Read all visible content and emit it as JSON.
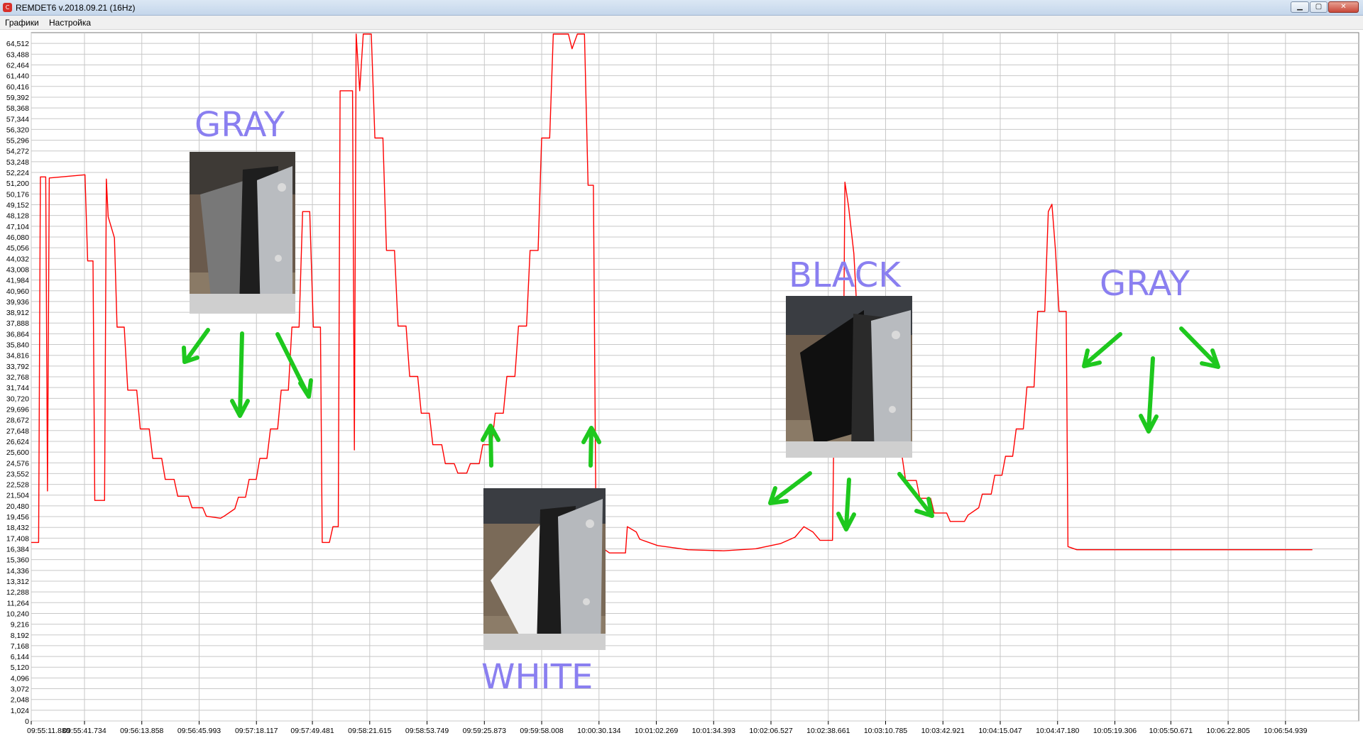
{
  "window": {
    "title": "REMDET6 v.2018.09.21 (16Hz)",
    "app_icon": "app-logo-icon",
    "controls": {
      "minimize": "▁",
      "maximize": "▢",
      "close": "✕"
    }
  },
  "menu": {
    "items": [
      "Графики",
      "Настройка"
    ]
  },
  "colors": {
    "series": "#ff0000",
    "grid": "#c8c8c8",
    "annotation_text": "#8a7ff0",
    "arrow": "#1ec81e"
  },
  "chart_data": {
    "type": "line",
    "grid": true,
    "ylim": [
      0,
      65536
    ],
    "y_step": 1024,
    "yticks": [
      "0",
      "1,024",
      "2,048",
      "3,072",
      "4,096",
      "5,120",
      "6,144",
      "7,168",
      "8,192",
      "9,216",
      "10,240",
      "11,264",
      "12,288",
      "13,312",
      "14,336",
      "15,360",
      "16,384",
      "17,408",
      "18,432",
      "19,456",
      "20,480",
      "21,504",
      "22,528",
      "23,552",
      "24,576",
      "25,600",
      "26,624",
      "27,648",
      "28,672",
      "29,696",
      "30,720",
      "31,744",
      "32,768",
      "33,792",
      "34,816",
      "35,840",
      "36,864",
      "37,888",
      "38,912",
      "39,936",
      "40,960",
      "41,984",
      "43,008",
      "44,032",
      "45,056",
      "46,080",
      "47,104",
      "48,128",
      "49,152",
      "50,176",
      "51,200",
      "52,224",
      "53,248",
      "54,272",
      "55,296",
      "56,320",
      "57,344",
      "58,368",
      "59,392",
      "60,416",
      "61,440",
      "62,464",
      "63,488",
      "64,512"
    ],
    "xlim": [
      "09:55:11.880",
      "10:07:36.000"
    ],
    "xticks": [
      "09:55:11.880",
      "09:55:41.734",
      "09:56:13.858",
      "09:56:45.993",
      "09:57:18.117",
      "09:57:49.481",
      "09:58:21.615",
      "09:58:53.749",
      "09:59:25.873",
      "09:59:58.008",
      "10:00:30.134",
      "10:01:02.269",
      "10:01:34.393",
      "10:02:06.527",
      "10:02:38.661",
      "10:03:10.785",
      "10:03:42.921",
      "10:04:15.047",
      "10:04:47.180",
      "10:05:19.306",
      "10:05:50.671",
      "10:06:22.805",
      "10:06:54.939"
    ],
    "series": [
      {
        "points": [
          [
            "09:55:11.880",
            17000
          ],
          [
            "09:55:16.0",
            17000
          ],
          [
            "09:55:17.0",
            51800
          ],
          [
            "09:55:20.0",
            51800
          ],
          [
            "09:55:21.0",
            21900
          ],
          [
            "09:55:22.0",
            51700
          ],
          [
            "09:55:42.0",
            52000
          ],
          [
            "09:55:43.5",
            43800
          ],
          [
            "09:55:46.5",
            43800
          ],
          [
            "09:55:47.5",
            21000
          ],
          [
            "09:55:53.0",
            21000
          ],
          [
            "09:55:54.0",
            51600
          ],
          [
            "09:55:55.0",
            48000
          ],
          [
            "09:55:58.5",
            46000
          ],
          [
            "09:56:00.0",
            37500
          ],
          [
            "09:56:04.0",
            37500
          ],
          [
            "09:56:06.0",
            31500
          ],
          [
            "09:56:11.0",
            31500
          ],
          [
            "09:56:13.0",
            27800
          ],
          [
            "09:56:18.0",
            27800
          ],
          [
            "09:56:20.0",
            25000
          ],
          [
            "09:56:25.0",
            25000
          ],
          [
            "09:56:27.0",
            23000
          ],
          [
            "09:56:32.0",
            23000
          ],
          [
            "09:56:34.0",
            21400
          ],
          [
            "09:56:40.0",
            21400
          ],
          [
            "09:56:42.0",
            20300
          ],
          [
            "09:56:48.0",
            20300
          ],
          [
            "09:56:50.0",
            19500
          ],
          [
            "09:56:58.0",
            19300
          ],
          [
            "09:57:00.0",
            19500
          ],
          [
            "09:57:06.0",
            20200
          ],
          [
            "09:57:08.0",
            21300
          ],
          [
            "09:57:12.0",
            21300
          ],
          [
            "09:57:14.0",
            23000
          ],
          [
            "09:57:18.0",
            23000
          ],
          [
            "09:57:20.0",
            25000
          ],
          [
            "09:57:24.0",
            25000
          ],
          [
            "09:57:26.0",
            27800
          ],
          [
            "09:57:30.0",
            27800
          ],
          [
            "09:57:32.0",
            31500
          ],
          [
            "09:57:36.0",
            31500
          ],
          [
            "09:57:38.0",
            37500
          ],
          [
            "09:57:42.0",
            37500
          ],
          [
            "09:57:44.0",
            48500
          ],
          [
            "09:57:48.0",
            48500
          ],
          [
            "09:57:50.0",
            37500
          ],
          [
            "09:57:54.0",
            37500
          ],
          [
            "09:57:55.0",
            17000
          ],
          [
            "09:57:59.0",
            17000
          ],
          [
            "09:58:01.0",
            18500
          ],
          [
            "09:58:04.0",
            18500
          ],
          [
            "09:58:05.0",
            60000
          ],
          [
            "09:58:12.0",
            60000
          ],
          [
            "09:58:13.0",
            25800
          ],
          [
            "09:58:14.0",
            65400
          ],
          [
            "09:58:16.0",
            60000
          ],
          [
            "09:58:18.0",
            65400
          ],
          [
            "09:58:22.5",
            65400
          ],
          [
            "09:58:24.5",
            55500
          ],
          [
            "09:58:29.0",
            55500
          ],
          [
            "09:58:31.0",
            44800
          ],
          [
            "09:58:35.5",
            44800
          ],
          [
            "09:58:37.5",
            37600
          ],
          [
            "09:58:42.0",
            37600
          ],
          [
            "09:58:44.0",
            32800
          ],
          [
            "09:58:48.5",
            32800
          ],
          [
            "09:58:50.5",
            29300
          ],
          [
            "09:58:55.0",
            29300
          ],
          [
            "09:58:57.0",
            26300
          ],
          [
            "09:59:02.0",
            26300
          ],
          [
            "09:59:04.0",
            24500
          ],
          [
            "09:59:09.0",
            24500
          ],
          [
            "09:59:11.0",
            23600
          ],
          [
            "09:59:16.0",
            23600
          ],
          [
            "09:59:18.0",
            24500
          ],
          [
            "09:59:23.0",
            24500
          ],
          [
            "09:59:25.0",
            26300
          ],
          [
            "09:59:30.0",
            26300
          ],
          [
            "09:59:32.0",
            29300
          ],
          [
            "09:59:36.5",
            29300
          ],
          [
            "09:59:38.5",
            32800
          ],
          [
            "09:59:43.0",
            32800
          ],
          [
            "09:59:45.0",
            37600
          ],
          [
            "09:59:49.5",
            37600
          ],
          [
            "09:59:51.5",
            44800
          ],
          [
            "09:59:56.0",
            44800
          ],
          [
            "09:59:58.0",
            55500
          ],
          [
            "10:00:02.5",
            55500
          ],
          [
            "10:00:04.5",
            65400
          ],
          [
            "10:00:13.0",
            65400
          ],
          [
            "10:00:15.0",
            64000
          ],
          [
            "10:00:18.0",
            65400
          ],
          [
            "10:00:22.0",
            65400
          ],
          [
            "10:00:24.0",
            51000
          ],
          [
            "10:00:27.0",
            51000
          ],
          [
            "10:00:28.5",
            16900
          ],
          [
            "10:00:36.0",
            16000
          ],
          [
            "10:00:45.0",
            16000
          ],
          [
            "10:00:46.0",
            18500
          ],
          [
            "10:00:51.0",
            18000
          ],
          [
            "10:00:53.0",
            17300
          ],
          [
            "10:01:03.0",
            16700
          ],
          [
            "10:01:20.0",
            16300
          ],
          [
            "10:01:40.0",
            16200
          ],
          [
            "10:01:58.0",
            16400
          ],
          [
            "10:02:12.0",
            16900
          ],
          [
            "10:02:20.0",
            17500
          ],
          [
            "10:02:25.0",
            18500
          ],
          [
            "10:02:30.0",
            18000
          ],
          [
            "10:02:34.0",
            17200
          ],
          [
            "10:02:41.0",
            17200
          ],
          [
            "10:02:42.0",
            30700
          ],
          [
            "10:02:47.0",
            30700
          ],
          [
            "10:02:48.0",
            51300
          ],
          [
            "10:02:50.0",
            49000
          ],
          [
            "10:02:53.0",
            44500
          ],
          [
            "10:02:55.0",
            38200
          ],
          [
            "10:02:59.0",
            38200
          ],
          [
            "10:03:01.0",
            31800
          ],
          [
            "10:03:06.0",
            31800
          ],
          [
            "10:03:08.0",
            27800
          ],
          [
            "10:03:13.0",
            27800
          ],
          [
            "10:03:15.0",
            25200
          ],
          [
            "10:03:20.0",
            25200
          ],
          [
            "10:03:22.0",
            22900
          ],
          [
            "10:03:28.0",
            22900
          ],
          [
            "10:03:30.0",
            21200
          ],
          [
            "10:03:36.0",
            21200
          ],
          [
            "10:03:38.0",
            19800
          ],
          [
            "10:03:45.0",
            19800
          ],
          [
            "10:03:47.0",
            19000
          ],
          [
            "10:03:55.0",
            19000
          ],
          [
            "10:03:57.0",
            19600
          ],
          [
            "10:04:03.0",
            20300
          ],
          [
            "10:04:05.0",
            21600
          ],
          [
            "10:04:10.0",
            21600
          ],
          [
            "10:04:12.0",
            23400
          ],
          [
            "10:04:16.0",
            23400
          ],
          [
            "10:04:18.0",
            25200
          ],
          [
            "10:04:22.0",
            25200
          ],
          [
            "10:04:24.0",
            27800
          ],
          [
            "10:04:28.0",
            27800
          ],
          [
            "10:04:30.0",
            31800
          ],
          [
            "10:04:34.0",
            31800
          ],
          [
            "10:04:36.0",
            39000
          ],
          [
            "10:04:40.0",
            39000
          ],
          [
            "10:04:42.0",
            48500
          ],
          [
            "10:04:44.0",
            49200
          ],
          [
            "10:04:46.0",
            44800
          ],
          [
            "10:04:48.0",
            39000
          ],
          [
            "10:04:52.0",
            39000
          ],
          [
            "10:04:53.0",
            16600
          ],
          [
            "10:04:58.0",
            16300
          ],
          [
            "10:07:10.0",
            16300
          ]
        ]
      }
    ]
  },
  "annotations": [
    {
      "label": "GRAY",
      "photo": "gray-card-photo"
    },
    {
      "label": "WHITE",
      "photo": "white-card-photo"
    },
    {
      "label": "BLACK",
      "photo": "black-card-photo"
    },
    {
      "label": "GRAY",
      "photo": "gray-card-photo"
    }
  ]
}
